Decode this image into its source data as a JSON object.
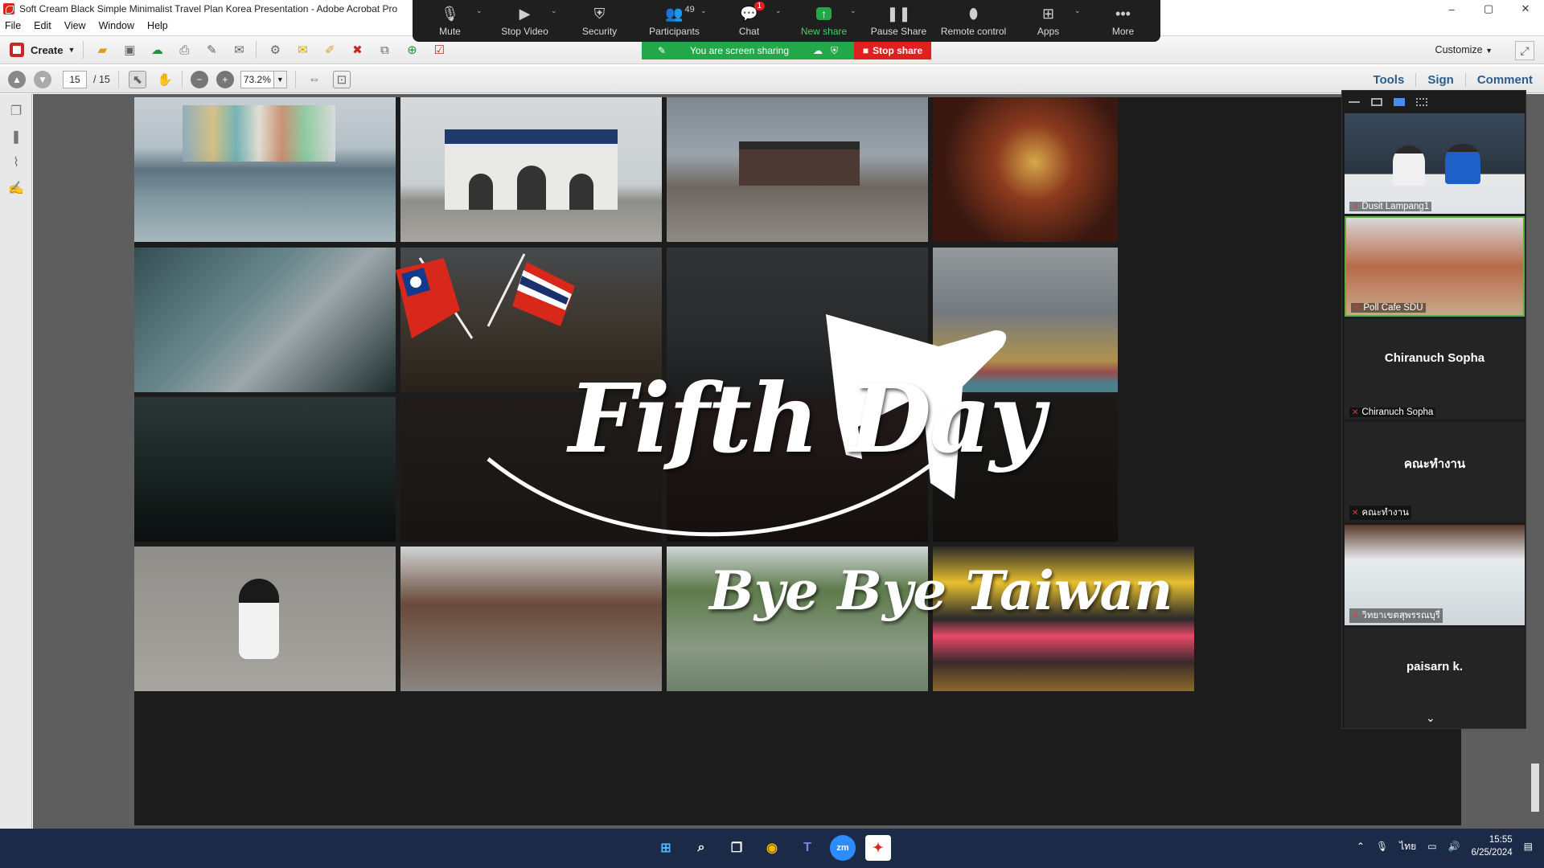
{
  "window": {
    "title": "Soft Cream Black Simple Minimalist Travel Plan Korea Presentation - Adobe Acrobat Pro",
    "controls": [
      "–",
      "▢",
      "✕"
    ]
  },
  "menu": [
    "File",
    "Edit",
    "View",
    "Window",
    "Help"
  ],
  "toolbar": {
    "create_label": "Create",
    "customize_label": "Customize",
    "page_current": "15",
    "page_total": "/ 15",
    "zoom_value": "73.2%"
  },
  "right_tabs": [
    "Tools",
    "Sign",
    "Comment"
  ],
  "slide": {
    "title": "Fifth Day",
    "subtitle": "Bye Bye Taiwan"
  },
  "zoom_toolbar": {
    "items": [
      {
        "label": "Mute",
        "icon": "microphone-icon"
      },
      {
        "label": "Stop Video",
        "icon": "video-camera-icon"
      },
      {
        "label": "Security",
        "icon": "shield-icon"
      },
      {
        "label": "Participants",
        "icon": "people-icon",
        "count": "49"
      },
      {
        "label": "Chat",
        "icon": "chat-bubble-icon",
        "badge": "1"
      },
      {
        "label": "New share",
        "icon": "share-arrow-icon"
      },
      {
        "label": "Pause Share",
        "icon": "pause-icon"
      },
      {
        "label": "Remote control",
        "icon": "mouse-icon"
      },
      {
        "label": "Apps",
        "icon": "apps-icon"
      },
      {
        "label": "More",
        "icon": "more-dots-icon"
      }
    ],
    "sharing_text": "You are screen sharing",
    "stop_share_label": "Stop share"
  },
  "participants": [
    {
      "name": "Dusit Lampang1",
      "type": "video"
    },
    {
      "name": "Poll Cafe SDU",
      "type": "video"
    },
    {
      "display": "Chiranuch Sopha",
      "name": "Chiranuch Sopha",
      "type": "name"
    },
    {
      "display": "คณะทำงาน",
      "name": "คณะทำงาน",
      "type": "name"
    },
    {
      "name": "วิทยาเขตสุพรรณบุรี",
      "type": "video"
    },
    {
      "display": "paisarn k.",
      "name": "paisarn k.",
      "type": "name"
    }
  ],
  "taskbar": {
    "lang": "ไทย",
    "time": "15:55",
    "date": "6/25/2024"
  },
  "colors": {
    "zoom_green": "#23a849",
    "zoom_red": "#e02020",
    "acrobat_blue": "#2c5d8f"
  }
}
